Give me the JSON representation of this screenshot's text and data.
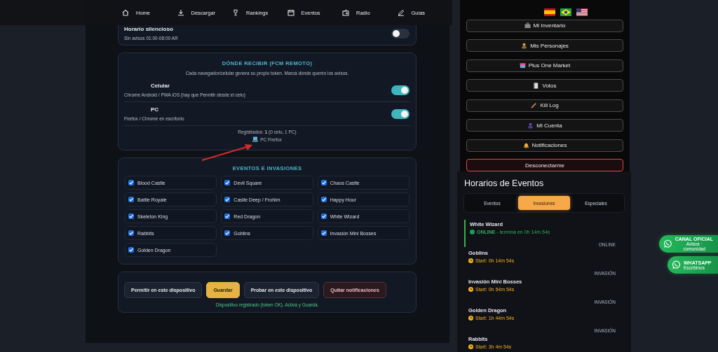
{
  "nav": [
    {
      "label": "Home"
    },
    {
      "label": "Descargar"
    },
    {
      "label": "Rankings"
    },
    {
      "label": "Eventos"
    },
    {
      "label": "Radio"
    },
    {
      "label": "Guias"
    }
  ],
  "quiet_card": {
    "title": "Horario silencioso",
    "subtitle": "Sin avisos 01:00-08:00 AR",
    "on": false
  },
  "receive_card": {
    "title": "DÓNDE RECIBIR (FCM REMOTO)",
    "description": "Cada navegador/celular genera su propio token. Marcá dónde querés los avisos.",
    "devices": [
      {
        "name": "Celular",
        "detail": "Chrome Android / PWA iOS (hay que Permitir desde el celu)",
        "on": true
      },
      {
        "name": "PC",
        "detail": "Firefox / Chrome en escritorio",
        "on": true
      }
    ],
    "registered": "Registrados: **1** (0 celu, 1 PC)",
    "device_entry": "PC Firefox"
  },
  "events_card": {
    "title": "EVENTOS E INVASIONES",
    "items": [
      {
        "label": "Blood Castle",
        "checked": true
      },
      {
        "label": "Devil Square",
        "checked": true
      },
      {
        "label": "Chaos Castle",
        "checked": true
      },
      {
        "label": "Battle Royale",
        "checked": true
      },
      {
        "label": "Castle Deep / Frohim",
        "checked": true
      },
      {
        "label": "Happy Hour",
        "checked": true
      },
      {
        "label": "Skeleton King",
        "checked": true
      },
      {
        "label": "Red Dragon",
        "checked": true
      },
      {
        "label": "White Wizard",
        "checked": true
      },
      {
        "label": "Rabbits",
        "checked": true
      },
      {
        "label": "Goblins",
        "checked": true
      },
      {
        "label": "Invasión Mini Bosses",
        "checked": true
      },
      {
        "label": "Golden Dragon",
        "checked": true
      }
    ]
  },
  "actions": {
    "buttons": [
      {
        "label": "Permitir en este dispositivo",
        "kind": "default"
      },
      {
        "label": "Guardar",
        "kind": "primary"
      },
      {
        "label": "Probar en este dispositivo",
        "kind": "default"
      },
      {
        "label": "Quitar notificaciones",
        "kind": "danger"
      }
    ],
    "status": "Dispositivo registrado (token OK). Activá y Guardá."
  },
  "menu": [
    {
      "label": "Mi Inventario",
      "kind": "default"
    },
    {
      "label": "Mis Personajes",
      "kind": "default"
    },
    {
      "label": "Plus One Market",
      "kind": "default"
    },
    {
      "label": "Votos",
      "kind": "default"
    },
    {
      "label": "Kill Log",
      "kind": "default"
    },
    {
      "label": "Mi Cuenta",
      "kind": "default"
    },
    {
      "label": "Notificaciones",
      "kind": "default"
    },
    {
      "label": "Desconectarme",
      "kind": "danger"
    }
  ],
  "schedule": {
    "title": "Horarios de Eventos",
    "tabs": [
      {
        "label": "Eventos",
        "selected": false
      },
      {
        "label": "Invasiones",
        "selected": true
      },
      {
        "label": "Especiales",
        "selected": false
      }
    ],
    "items": [
      {
        "name": "White Wizard",
        "kind": "online",
        "status": "ONLINE",
        "status_detail": " - termina en 0h 14m 54s",
        "tag": "ONLINE"
      },
      {
        "name": "Goblins",
        "kind": "start",
        "status": "Start: 0h 14m 54s",
        "tag": "INVASIÓN"
      },
      {
        "name": "Invasión Mini Bosses",
        "kind": "start",
        "status": "Start: 0h 54m 54s",
        "tag": "INVASIÓN"
      },
      {
        "name": "Golden Dragon",
        "kind": "start",
        "status": "Start: 1h 44m 54s",
        "tag": "INVASIÓN"
      },
      {
        "name": "Rabbits",
        "kind": "start",
        "status": "Start: 3h 4m 54s"
      }
    ]
  },
  "floating": [
    {
      "title": "CANAL OFICIAL",
      "subtitle": "Avisos · comunidad"
    },
    {
      "title": "WHATSAPP",
      "subtitle": "Escribinos"
    }
  ]
}
